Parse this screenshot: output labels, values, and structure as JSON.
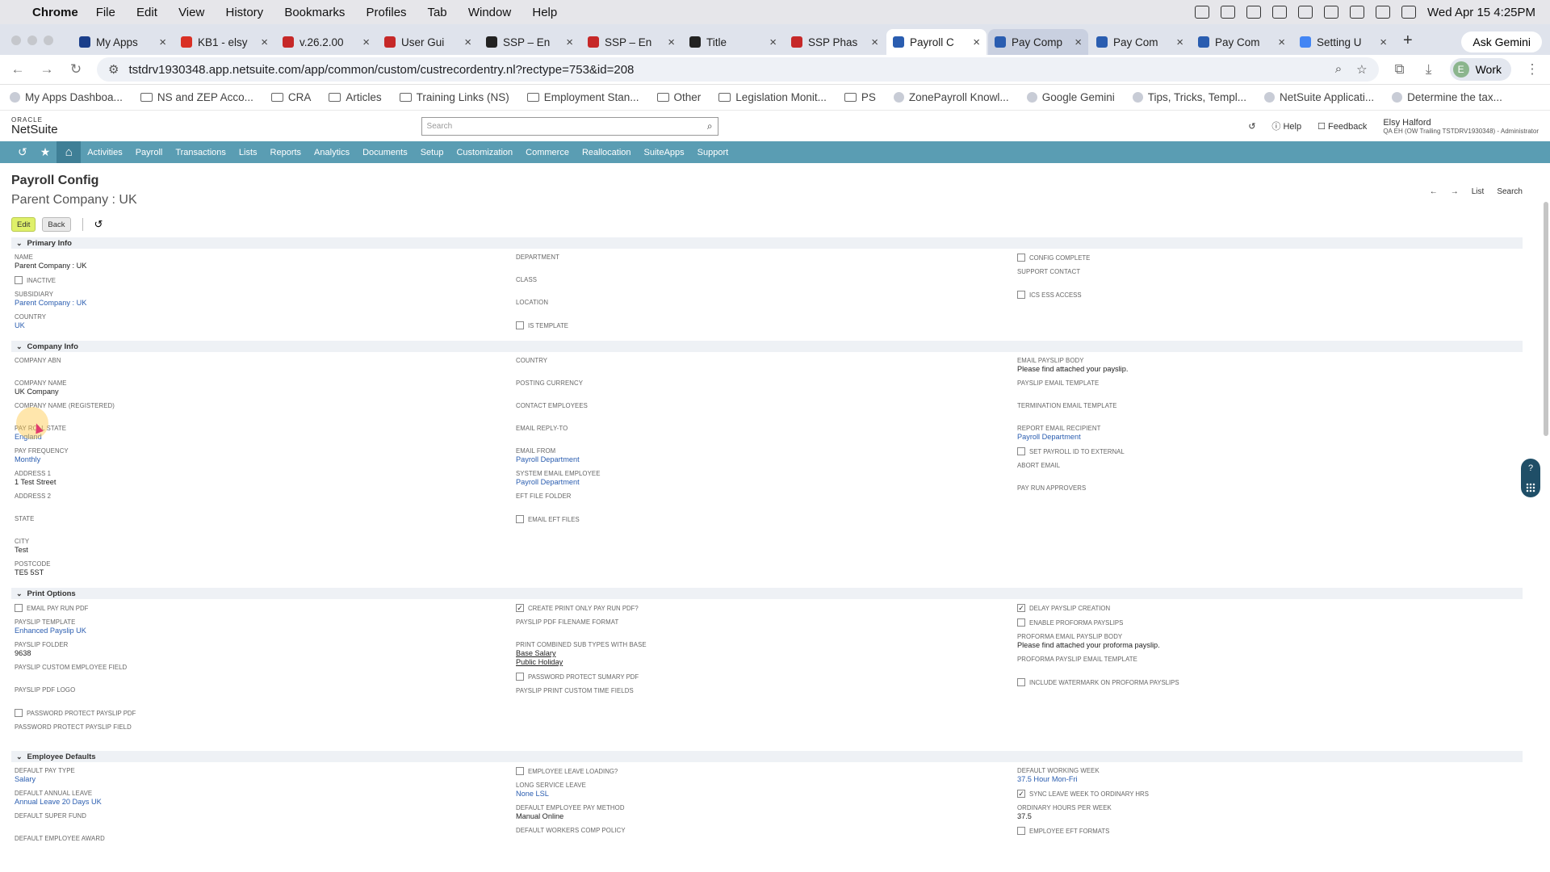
{
  "macbar": {
    "app": "Chrome",
    "menus": [
      "File",
      "Edit",
      "View",
      "History",
      "Bookmarks",
      "Profiles",
      "Tab",
      "Window",
      "Help"
    ],
    "datetime": "Wed Apr 15  4:25PM"
  },
  "tabs": [
    {
      "label": "My Apps",
      "color": "#1a3e8a"
    },
    {
      "label": "KB1 - elsy",
      "color": "#d93025"
    },
    {
      "label": "v.26.2.00",
      "color": "#c62828"
    },
    {
      "label": "User Gui",
      "color": "#c62828"
    },
    {
      "label": "SSP – En",
      "color": "#222222"
    },
    {
      "label": "SSP – En",
      "color": "#c62828"
    },
    {
      "label": "Title",
      "color": "#222222"
    },
    {
      "label": "SSP Phas",
      "color": "#c62828"
    },
    {
      "label": "Payroll C",
      "color": "#2a5db0",
      "active": true
    },
    {
      "label": "Pay Comp",
      "color": "#2a5db0",
      "highlighted": true
    },
    {
      "label": "Pay Com",
      "color": "#2a5db0"
    },
    {
      "label": "Pay Com",
      "color": "#2a5db0"
    },
    {
      "label": "Setting U",
      "color": "#4285f4"
    }
  ],
  "ask_gemini": "Ask Gemini",
  "address": {
    "url": "tstdrv1930348.app.netsuite.com/app/common/custom/custrecordentry.nl?rectype=753&id=208",
    "profile_initial": "E",
    "profile_label": "Work"
  },
  "bookmarks": [
    {
      "label": "My Apps Dashboa...",
      "type": "site"
    },
    {
      "label": "NS and ZEP Acco...",
      "type": "folder"
    },
    {
      "label": "CRA",
      "type": "folder"
    },
    {
      "label": "Articles",
      "type": "folder"
    },
    {
      "label": "Training Links (NS)",
      "type": "folder"
    },
    {
      "label": "Employment Stan...",
      "type": "folder"
    },
    {
      "label": "Other",
      "type": "folder"
    },
    {
      "label": "Legislation Monit...",
      "type": "folder"
    },
    {
      "label": "PS",
      "type": "folder"
    },
    {
      "label": "ZonePayroll Knowl...",
      "type": "site"
    },
    {
      "label": "Google Gemini",
      "type": "site"
    },
    {
      "label": "Tips, Tricks, Templ...",
      "type": "site"
    },
    {
      "label": "NetSuite Applicati...",
      "type": "site"
    },
    {
      "label": "Determine the tax...",
      "type": "site"
    }
  ],
  "netsuite": {
    "logo_top": "ORACLE",
    "logo_bottom": "NetSuite",
    "search_placeholder": "Search",
    "help": "Help",
    "feedback": "Feedback",
    "user_name": "Elsy Halford",
    "user_role": "QA EH (OW Trailing TSTDRV1930348) - Administrator",
    "nav": [
      "Activities",
      "Payroll",
      "Transactions",
      "Lists",
      "Reports",
      "Analytics",
      "Documents",
      "Setup",
      "Customization",
      "Commerce",
      "Reallocation",
      "SuiteApps",
      "Support"
    ]
  },
  "page": {
    "title": "Payroll Config",
    "subtitle": "Parent Company : UK",
    "edit": "Edit",
    "back": "Back",
    "list": "List",
    "search": "Search"
  },
  "sections": {
    "primary": {
      "title": "Primary Info",
      "name_label": "NAME",
      "name": "Parent Company : UK",
      "inactive": "INACTIVE",
      "subsidiary_label": "SUBSIDIARY",
      "subsidiary": "Parent Company : UK",
      "country_label": "COUNTRY",
      "country": "UK",
      "department": "DEPARTMENT",
      "class": "CLASS",
      "location": "LOCATION",
      "is_template": "IS TEMPLATE",
      "config_complete": "CONFIG COMPLETE",
      "support_contact": "SUPPORT CONTACT",
      "ics_ess": "ICS ESS ACCESS"
    },
    "company": {
      "title": "Company Info",
      "abn": "COMPANY ABN",
      "name_label": "COMPANY NAME",
      "name": "UK Company",
      "registered": "COMPANY NAME (REGISTERED)",
      "state_label": "PAY ROLL STATE",
      "state": "England",
      "freq_label": "PAY FREQUENCY",
      "freq": "Monthly",
      "addr1_label": "ADDRESS 1",
      "addr1": "1 Test Street",
      "addr2": "ADDRESS 2",
      "st": "STATE",
      "city_label": "CITY",
      "city": "Test",
      "postcode_label": "POSTCODE",
      "postcode": "TE5 5ST",
      "country": "COUNTRY",
      "posting_currency": "POSTING CURRENCY",
      "contact_employees": "CONTACT EMPLOYEES",
      "reply_to": "EMAIL REPLY-TO",
      "email_from_label": "EMAIL FROM",
      "email_from": "Payroll Department",
      "sys_email_label": "SYSTEM EMAIL EMPLOYEE",
      "sys_email": "Payroll Department",
      "eft_folder": "EFT FILE FOLDER",
      "email_eft": "EMAIL EFT FILES",
      "payslip_body_label": "EMAIL PAYSLIP BODY",
      "payslip_body": "Please find attached your payslip.",
      "payslip_tpl": "PAYSLIP EMAIL TEMPLATE",
      "term_tpl": "TERMINATION EMAIL TEMPLATE",
      "report_recipient_label": "REPORT EMAIL RECIPIENT",
      "report_recipient": "Payroll Department",
      "set_payroll_id": "SET PAYROLL ID TO EXTERNAL",
      "abort_email": "ABORT EMAIL",
      "approvers": "PAY RUN APPROVERS"
    },
    "print": {
      "title": "Print Options",
      "email_pay_run": "EMAIL PAY RUN PDF",
      "tpl_label": "PAYSLIP TEMPLATE",
      "tpl": "Enhanced Payslip UK",
      "folder_label": "PAYSLIP FOLDER",
      "folder": "9638",
      "custom_emp": "PAYSLIP CUSTOM EMPLOYEE FIELD",
      "logo": "PAYSLIP PDF LOGO",
      "pwd_payslip": "PASSWORD PROTECT PAYSLIP PDF",
      "pwd_field": "PASSWORD PROTECT PAYSLIP FIELD",
      "create_print": "CREATE PRINT ONLY PAY RUN PDF?",
      "filename": "PAYSLIP PDF FILENAME FORMAT",
      "combined_label": "PRINT COMBINED SUB TYPES WITH BASE",
      "combined1": "Base Salary",
      "combined2": "Public Holiday",
      "pwd_summary": "PASSWORD PROTECT SUMARY PDF",
      "custom_time": "PAYSLIP PRINT CUSTOM TIME FIELDS",
      "delay": "DELAY PAYSLIP CREATION",
      "proforma": "ENABLE PROFORMA PAYSLIPS",
      "proforma_body_label": "PROFORMA EMAIL PAYSLIP BODY",
      "proforma_body": "Please find attached your proforma payslip.",
      "proforma_tpl": "PROFORMA PAYSLIP EMAIL TEMPLATE",
      "watermark": "INCLUDE WATERMARK ON PROFORMA PAYSLIPS"
    },
    "employee": {
      "title": "Employee Defaults",
      "pay_type_label": "DEFAULT PAY TYPE",
      "pay_type": "Salary",
      "annual_label": "DEFAULT ANNUAL LEAVE",
      "annual": "Annual Leave 20 Days UK",
      "super": "DEFAULT SUPER FUND",
      "award": "DEFAULT EMPLOYEE AWARD",
      "leave_loading": "EMPLOYEE LEAVE LOADING?",
      "lsl_label": "LONG SERVICE LEAVE",
      "lsl": "None LSL",
      "method_label": "DEFAULT EMPLOYEE PAY METHOD",
      "method": "Manual Online",
      "workers_comp": "DEFAULT WORKERS COMP POLICY",
      "week_label": "DEFAULT WORKING WEEK",
      "week": "37.5 Hour Mon-Fri",
      "sync": "SYNC LEAVE WEEK TO ORDINARY HRS",
      "hours_label": "ORDINARY HOURS PER WEEK",
      "hours": "37.5",
      "eft": "EMPLOYEE EFT FORMATS"
    }
  }
}
